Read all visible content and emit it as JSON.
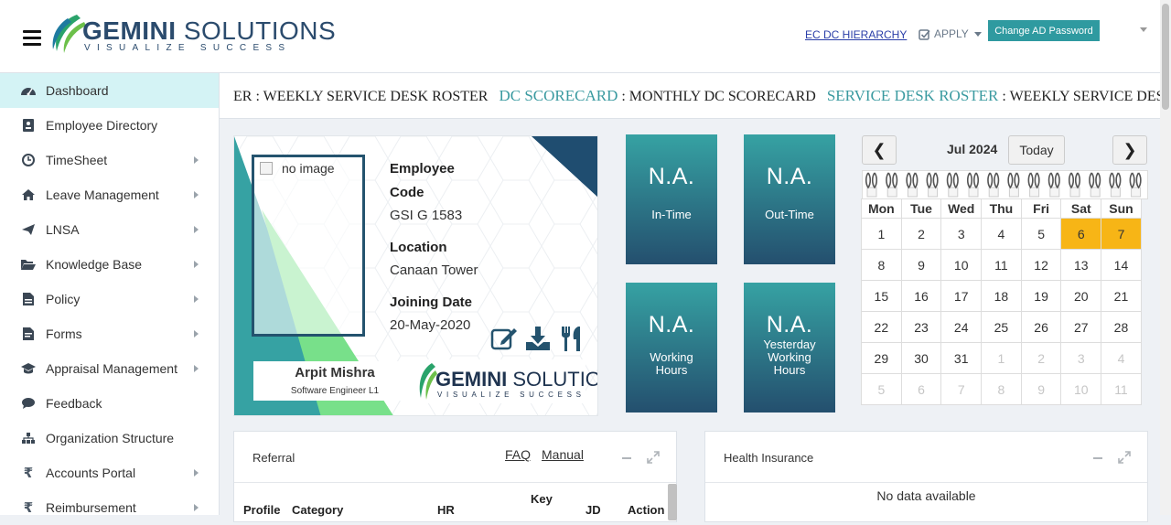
{
  "header": {
    "logo_brand": "GEMINI",
    "logo_brand_rest": " SOLUTIONS",
    "logo_tagline": "VISUALIZE SUCCESS",
    "ec_dc_link": "EC DC HIERARCHY",
    "apply_label": "APPLY",
    "change_password_label": "Change AD Password"
  },
  "sidebar": {
    "items": [
      {
        "label": "Dashboard",
        "icon": "dashboard-icon"
      },
      {
        "label": "Employee Directory",
        "icon": "id-card-icon"
      },
      {
        "label": "TimeSheet",
        "icon": "clock-icon"
      },
      {
        "label": "Leave Management",
        "icon": "home-icon"
      },
      {
        "label": "LNSA",
        "icon": "paper-plane-icon"
      },
      {
        "label": "Knowledge Base",
        "icon": "folder-open-icon"
      },
      {
        "label": "Policy",
        "icon": "document-icon"
      },
      {
        "label": "Forms",
        "icon": "form-icon"
      },
      {
        "label": "Appraisal Management",
        "icon": "graduation-cap-icon"
      },
      {
        "label": "Feedback",
        "icon": "comments-icon"
      },
      {
        "label": "Organization Structure",
        "icon": "sitemap-icon"
      },
      {
        "label": "Accounts Portal",
        "icon": "rupee-icon"
      },
      {
        "label": "Reimbursement",
        "icon": "rupee-icon"
      }
    ]
  },
  "ticker": {
    "items": [
      {
        "title": "",
        "text": "ER : WEEKLY SERVICE DESK ROSTER"
      },
      {
        "title": "DC SCORECARD",
        "text": " : MONTHLY DC SCORECARD"
      },
      {
        "title": "SERVICE DESK ROSTER",
        "text": " : WEEKLY SERVICE DESK ROSTER"
      }
    ]
  },
  "profile": {
    "image_alt": "no image",
    "code_label_1": "Employee",
    "code_label_2": "Code",
    "code_value": "GSI G 1583",
    "location_label": "Location",
    "location_value": "Canaan Tower",
    "joining_label": "Joining Date",
    "joining_value": "20-May-2020",
    "name": "Arpit Mishra",
    "designation": "Software Engineer L1",
    "card_logo_brand": "GEMINI",
    "card_logo_rest": " SOLUTIONS",
    "card_logo_tagline": "VISUALIZE SUCCESS"
  },
  "tiles": {
    "in_time": {
      "value": "N.A.",
      "label": "In-Time"
    },
    "out_time": {
      "value": "N.A.",
      "label": "Out-Time"
    },
    "working_hours": {
      "value": "N.A.",
      "label_1": "Working",
      "label_2": "Hours"
    },
    "yesterday_hours": {
      "value": "N.A.",
      "label_1": "Yesterday",
      "label_2": "Working",
      "label_3": "Hours"
    }
  },
  "calendar": {
    "title": "Jul 2024",
    "prev": "❮",
    "next": "❯",
    "today_label": "Today",
    "weekdays": [
      "Mon",
      "Tue",
      "Wed",
      "Thu",
      "Fri",
      "Sat",
      "Sun"
    ],
    "weeks": [
      [
        "1",
        "2",
        "3",
        "4",
        "5",
        "6",
        "7"
      ],
      [
        "8",
        "9",
        "10",
        "11",
        "12",
        "13",
        "14"
      ],
      [
        "15",
        "16",
        "17",
        "18",
        "19",
        "20",
        "21"
      ],
      [
        "22",
        "23",
        "24",
        "25",
        "26",
        "27",
        "28"
      ],
      [
        "29",
        "30",
        "31",
        "1",
        "2",
        "3",
        "4"
      ],
      [
        "5",
        "6",
        "7",
        "8",
        "9",
        "10",
        "11"
      ]
    ]
  },
  "referral": {
    "title": "Referral",
    "faq": "FAQ",
    "manual": "Manual",
    "columns": [
      "Profile",
      "Category",
      "HR",
      "Key",
      "JD",
      "Action"
    ]
  },
  "health": {
    "title": "Health Insurance",
    "empty": "No data available"
  },
  "colors": {
    "accent": "#2f9aa0",
    "tile_top": "#36a2a3",
    "tile_bottom": "#244f6e",
    "weekend_highlight": "#f7b516",
    "active_nav": "#d4f3f5"
  }
}
